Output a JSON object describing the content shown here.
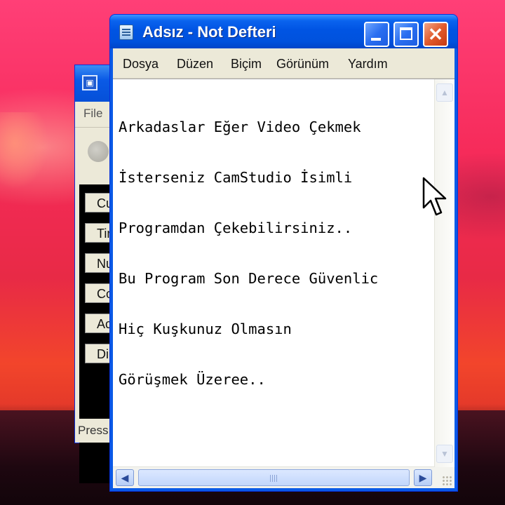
{
  "back_window": {
    "menu_file": "File",
    "items": [
      "Cu",
      "Tir",
      "Nu",
      "Co",
      "Ac",
      "Dir"
    ],
    "status": "Press"
  },
  "notepad": {
    "title": "Adsız - Not Defteri",
    "menu": [
      "Dosya",
      "Düzen",
      "Biçim",
      "Görünüm",
      "Yardım"
    ],
    "content_lines": [
      "Arkadaslar Eğer Video Çekmek",
      "İsterseniz CamStudio İsimli",
      "Programdan Çekebilirsiniz..",
      "Bu Program Son Derece Güvenlic",
      "Hiç Kuşkunuz Olmasın",
      "Görüşmek Üzeree.."
    ]
  },
  "icons": {
    "app": "notepad-icon",
    "minimize": "minimize-icon",
    "maximize": "maximize-icon",
    "close": "close-icon",
    "cursor": "mouse-pointer-icon"
  },
  "colors": {
    "titlebar_blue": "#0054e3",
    "close_red": "#e15a2c",
    "menu_bg": "#ece9d8"
  }
}
